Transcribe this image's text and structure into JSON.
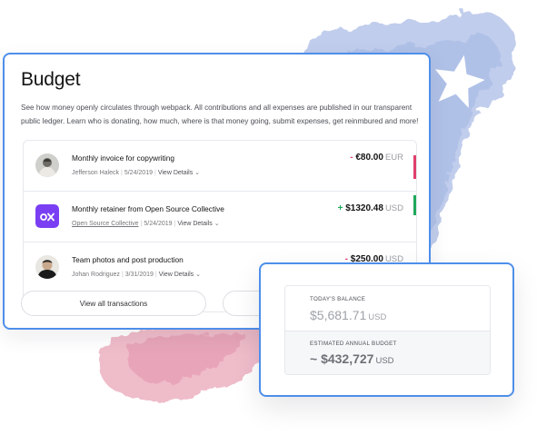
{
  "budget": {
    "title": "Budget",
    "description": "See how money openly circulates through webpack. All contributions and all expenses are published in our transparent public ledger. Learn who is donating, how much, where is that money going, submit expenses, get reinmbured and more!",
    "transactions": [
      {
        "title": "Monthly invoice for copywriting",
        "person": "Jefferson Haleck",
        "date": "5/24/2019",
        "details_link": "View Details",
        "sign": "-",
        "amount": "€80.00",
        "currency": "EUR",
        "avatar_icon": "person-photo-avatar"
      },
      {
        "title": "Monthly retainer from Open Source Collective",
        "person": "Open Source Collective",
        "date": "5/24/2019",
        "details_link": "View Details",
        "sign": "+",
        "amount": "$1320.48",
        "currency": "USD",
        "avatar_icon": "open-source-collective-logo"
      },
      {
        "title": "Team photos and post production",
        "person": "Johan Rodriguez",
        "date": "3/31/2019",
        "details_link": "View Details",
        "sign": "-",
        "amount": "$250.00",
        "currency": "USD",
        "avatar_icon": "person-photo-avatar"
      }
    ],
    "view_all_label": "View all transactions",
    "second_button_label": ""
  },
  "balance": {
    "today_label": "TODAY'S BALANCE",
    "today_value": "$5,681.71",
    "today_currency": "USD",
    "annual_label": "ESTIMATED ANNUAL BUDGET",
    "annual_value": "~ $432,727",
    "annual_currency": "USD"
  },
  "colors": {
    "accent_border": "#4e8fea",
    "negative": "#e03f6c",
    "positive": "#1fa85c",
    "osc_brand": "#7a3ff2"
  }
}
